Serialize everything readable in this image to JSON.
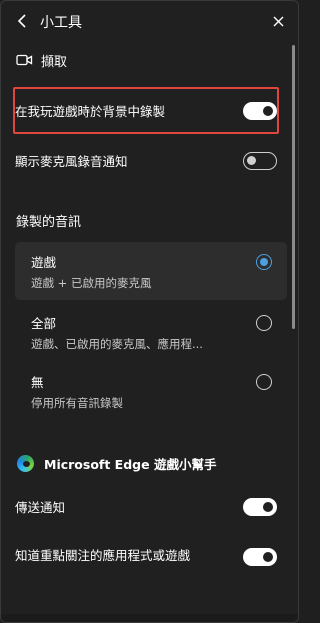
{
  "header": {
    "title": "小工具"
  },
  "capture": {
    "label": "擷取",
    "icon": "camera-icon"
  },
  "settings": {
    "record_background": {
      "label": "在我玩遊戲時於背景中錄製",
      "on": true
    },
    "mic_notification": {
      "label": "顯示麥克風錄音通知",
      "on": false
    }
  },
  "audio": {
    "section_title": "錄製的音訊",
    "options": [
      {
        "title": "遊戲",
        "desc": "遊戲 + 已啟用的麥克風",
        "selected": true
      },
      {
        "title": "全部",
        "desc": "遊戲、已啟用的麥克風、應用程...",
        "selected": false
      },
      {
        "title": "無",
        "desc": "停用所有音訊錄製",
        "selected": false
      }
    ]
  },
  "edge": {
    "title": "Microsoft Edge 遊戲小幫手",
    "icon": "edge-icon",
    "send_notifications": {
      "label": "傳送通知",
      "on": true
    },
    "focus_apps": {
      "label": "知道重點關注的應用程式或遊戲",
      "on": true
    }
  },
  "colors": {
    "background": "#202020",
    "accent": "#4ca0e0",
    "highlight_border": "#e0453e"
  }
}
